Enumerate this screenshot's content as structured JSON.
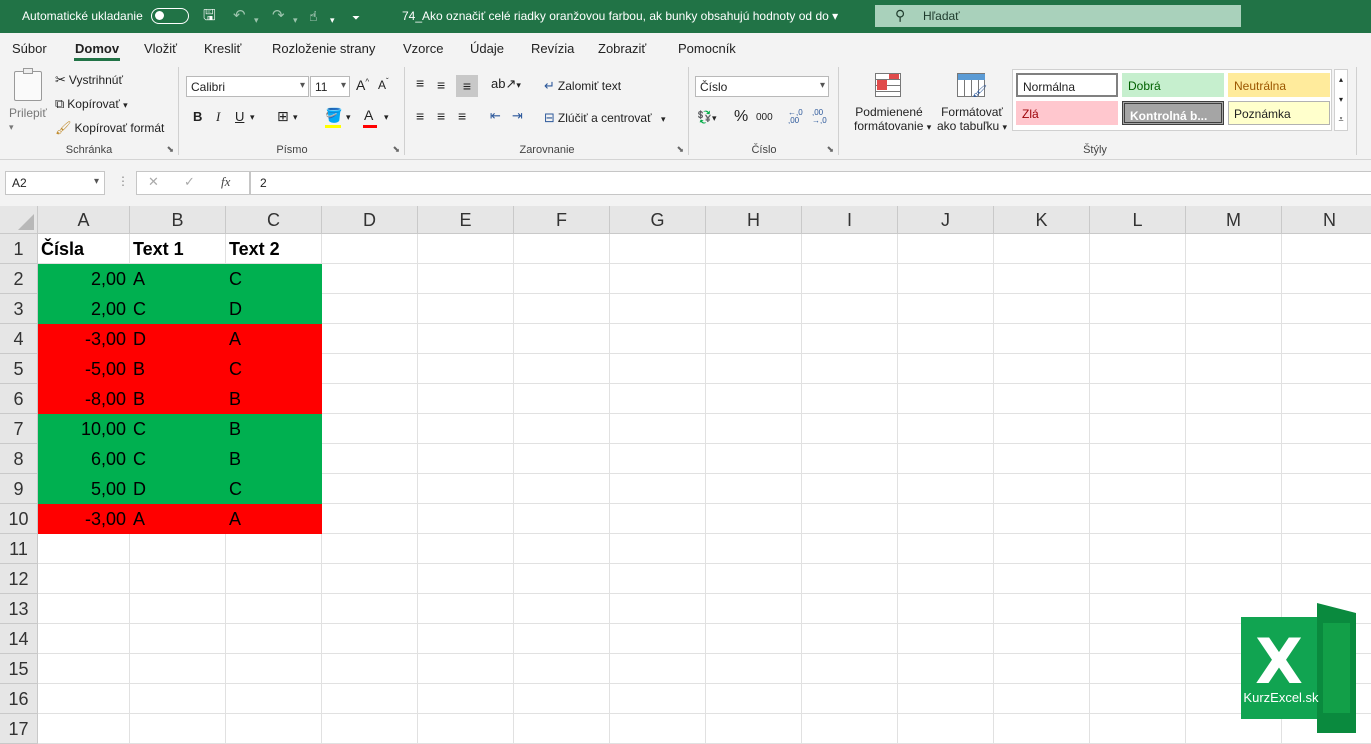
{
  "titlebar": {
    "autosave_label": "Automatické ukladanie",
    "document_title": "74_Ako označiť celé riadky oranžovou farbou, ak bunky obsahujú hodnoty od do",
    "search_placeholder": "Hľadať"
  },
  "tabs": [
    "Súbor",
    "Domov",
    "Vložiť",
    "Kresliť",
    "Rozloženie strany",
    "Vzorce",
    "Údaje",
    "Revízia",
    "Zobraziť",
    "Pomocník"
  ],
  "ribbon": {
    "clipboard": {
      "paste": "Prilepiť",
      "cut": "Vystrihnúť",
      "copy": "Kopírovať",
      "format_painter": "Kopírovať formát",
      "label": "Schránka"
    },
    "font": {
      "name": "Calibri",
      "size": "11",
      "bold": "B",
      "italic": "I",
      "underline": "U",
      "label": "Písmo",
      "grow": "A^",
      "shrink": "Aˇ"
    },
    "alignment": {
      "wrap": "Zalomiť text",
      "merge": "Zlúčiť a centrovať",
      "label": "Zarovnanie"
    },
    "number": {
      "format": "Číslo",
      "percent": "%",
      "thousands": "000",
      "label": "Číslo",
      "inc_dec": ",0 ,00",
      "dec_dec": ",00 ,0"
    },
    "styles": {
      "cond_format_line1": "Podmienené",
      "cond_format_line2": "formátovanie",
      "table_format_line1": "Formátovať",
      "table_format_line2": "ako tabuľku",
      "normal": "Normálna",
      "good": "Dobrá",
      "neutral": "Neutrálna",
      "bad": "Zlá",
      "check": "Kontrolná b...",
      "note": "Poznámka",
      "label": "Štýly"
    }
  },
  "formula_bar": {
    "namebox": "A2",
    "cancel": "✕",
    "enter": "✓",
    "fx": "fx",
    "value": "2"
  },
  "grid": {
    "columns": [
      "A",
      "B",
      "C",
      "D",
      "E",
      "F",
      "G",
      "H",
      "I",
      "J",
      "K",
      "L",
      "M",
      "N"
    ],
    "rows": [
      "1",
      "2",
      "3",
      "4",
      "5",
      "6",
      "7",
      "8",
      "9",
      "10",
      "11",
      "12",
      "13",
      "14",
      "15",
      "16",
      "17"
    ],
    "header": [
      "Čísla",
      "Text 1",
      "Text 2"
    ],
    "data": [
      {
        "a": "2,00",
        "b": "A",
        "c": "C",
        "fill": "green"
      },
      {
        "a": "2,00",
        "b": "C",
        "c": "D",
        "fill": "green"
      },
      {
        "a": "-3,00",
        "b": "D",
        "c": "A",
        "fill": "red"
      },
      {
        "a": "-5,00",
        "b": "B",
        "c": "C",
        "fill": "red"
      },
      {
        "a": "-8,00",
        "b": "B",
        "c": "B",
        "fill": "red"
      },
      {
        "a": "10,00",
        "b": "C",
        "c": "B",
        "fill": "green"
      },
      {
        "a": "6,00",
        "b": "C",
        "c": "B",
        "fill": "green"
      },
      {
        "a": "5,00",
        "b": "D",
        "c": "C",
        "fill": "green"
      },
      {
        "a": "-3,00",
        "b": "A",
        "c": "A",
        "fill": "red"
      }
    ]
  },
  "logo": {
    "letter": "X",
    "caption": "KurzExcel.sk"
  },
  "colors": {
    "excel_green": "#217346",
    "green_fill": "#00b050",
    "red_fill": "#ff0000"
  }
}
